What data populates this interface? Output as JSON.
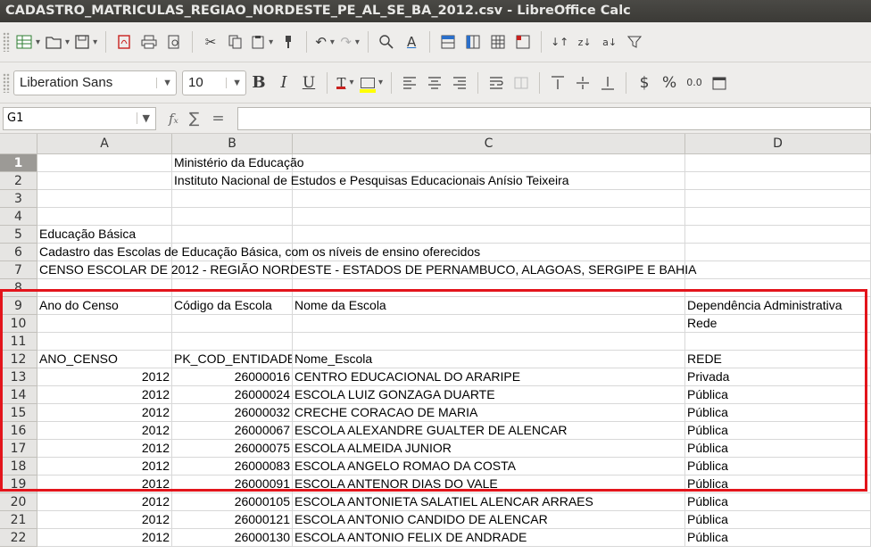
{
  "window": {
    "title": "CADASTRO_MATRICULAS_REGIAO_NORDESTE_PE_AL_SE_BA_2012.csv - LibreOffice Calc"
  },
  "toolbar_standard": {
    "icons": [
      "new-spreadsheet-icon",
      "open-folder-icon",
      "save-icon",
      "export-pdf-icon",
      "print-icon",
      "print-preview-icon",
      "cut-icon",
      "copy-icon",
      "paste-icon",
      "clone-formatting-icon",
      "undo-icon",
      "redo-icon",
      "find-replace-icon",
      "spelling-icon",
      "row-icon",
      "column-icon",
      "insert-table-icon",
      "freeze-icon",
      "sort-ascending-icon",
      "sort-descending-icon",
      "autofilter-icon"
    ]
  },
  "toolbar_formatting": {
    "font_name": "Liberation Sans",
    "font_size": "10",
    "bold": "B",
    "italic": "I",
    "underline": "U",
    "currency": "$",
    "percent": "%",
    "decimal": "0.0",
    "font_color": "#c9211e",
    "highlight_color": "#ffff00"
  },
  "formula_bar": {
    "cell_ref": "G1",
    "fx": "fₓ",
    "sum": "∑",
    "equals": "=",
    "content": ""
  },
  "columns": [
    "A",
    "B",
    "C",
    "D"
  ],
  "rows": [
    {
      "n": "1",
      "a": "",
      "b": "",
      "c": "",
      "d": "",
      "b_over": "Ministério da Educação",
      "active": true
    },
    {
      "n": "2",
      "a": "",
      "b": "",
      "c": "",
      "d": "",
      "b_over": "Instituto Nacional de Estudos e Pesquisas Educacionais Anísio Teixeira"
    },
    {
      "n": "3",
      "a": "",
      "b": "",
      "c": "",
      "d": ""
    },
    {
      "n": "4",
      "a": "",
      "b": "",
      "c": "",
      "d": ""
    },
    {
      "n": "5",
      "a": "",
      "b": "",
      "c": "",
      "d": "",
      "a_over": "Educação Básica"
    },
    {
      "n": "6",
      "a": "",
      "b": "",
      "c": "",
      "d": "",
      "a_over": "Cadastro das Escolas de Educação Básica, com os níveis de ensino oferecidos"
    },
    {
      "n": "7",
      "a": "",
      "b": "",
      "c": "",
      "d": "",
      "a_over": "CENSO ESCOLAR DE 2012 -  REGIÃO NORDESTE - ESTADOS DE PERNAMBUCO, ALAGOAS, SERGIPE E BAHIA"
    },
    {
      "n": "8",
      "a": "",
      "b": "",
      "c": "",
      "d": ""
    },
    {
      "n": "9",
      "a": "Ano do Censo",
      "b": "Código da Escola",
      "c": "Nome da Escola",
      "d": "Dependência Administrativa"
    },
    {
      "n": "10",
      "a": "",
      "b": "",
      "c": "",
      "d": "Rede"
    },
    {
      "n": "11",
      "a": "",
      "b": "",
      "c": "",
      "d": ""
    },
    {
      "n": "12",
      "a": "ANO_CENSO",
      "b": "PK_COD_ENTIDADE",
      "c": "Nome_Escola",
      "d": "REDE",
      "b_clip": true
    },
    {
      "n": "13",
      "a": "2012",
      "b": "26000016",
      "c": "CENTRO EDUCACIONAL DO ARARIPE",
      "d": "Privada",
      "num": true
    },
    {
      "n": "14",
      "a": "2012",
      "b": "26000024",
      "c": "ESCOLA LUIZ GONZAGA DUARTE",
      "d": "Pública",
      "num": true
    },
    {
      "n": "15",
      "a": "2012",
      "b": "26000032",
      "c": "CRECHE CORACAO DE MARIA",
      "d": "Pública",
      "num": true
    },
    {
      "n": "16",
      "a": "2012",
      "b": "26000067",
      "c": "ESCOLA ALEXANDRE GUALTER DE ALENCAR",
      "d": "Pública",
      "num": true
    },
    {
      "n": "17",
      "a": "2012",
      "b": "26000075",
      "c": "ESCOLA ALMEIDA JUNIOR",
      "d": "Pública",
      "num": true
    },
    {
      "n": "18",
      "a": "2012",
      "b": "26000083",
      "c": "ESCOLA ANGELO ROMAO DA COSTA",
      "d": "Pública",
      "num": true
    },
    {
      "n": "19",
      "a": "2012",
      "b": "26000091",
      "c": "ESCOLA ANTENOR DIAS DO VALE",
      "d": "Pública",
      "num": true
    },
    {
      "n": "20",
      "a": "2012",
      "b": "26000105",
      "c": "ESCOLA ANTONIETA SALATIEL ALENCAR ARRAES",
      "d": "Pública",
      "num": true
    },
    {
      "n": "21",
      "a": "2012",
      "b": "26000121",
      "c": "ESCOLA ANTONIO CANDIDO DE ALENCAR",
      "d": "Pública",
      "num": true
    },
    {
      "n": "22",
      "a": "2012",
      "b": "26000130",
      "c": "ESCOLA ANTONIO FELIX DE ANDRADE",
      "d": "Pública",
      "num": true
    }
  ]
}
